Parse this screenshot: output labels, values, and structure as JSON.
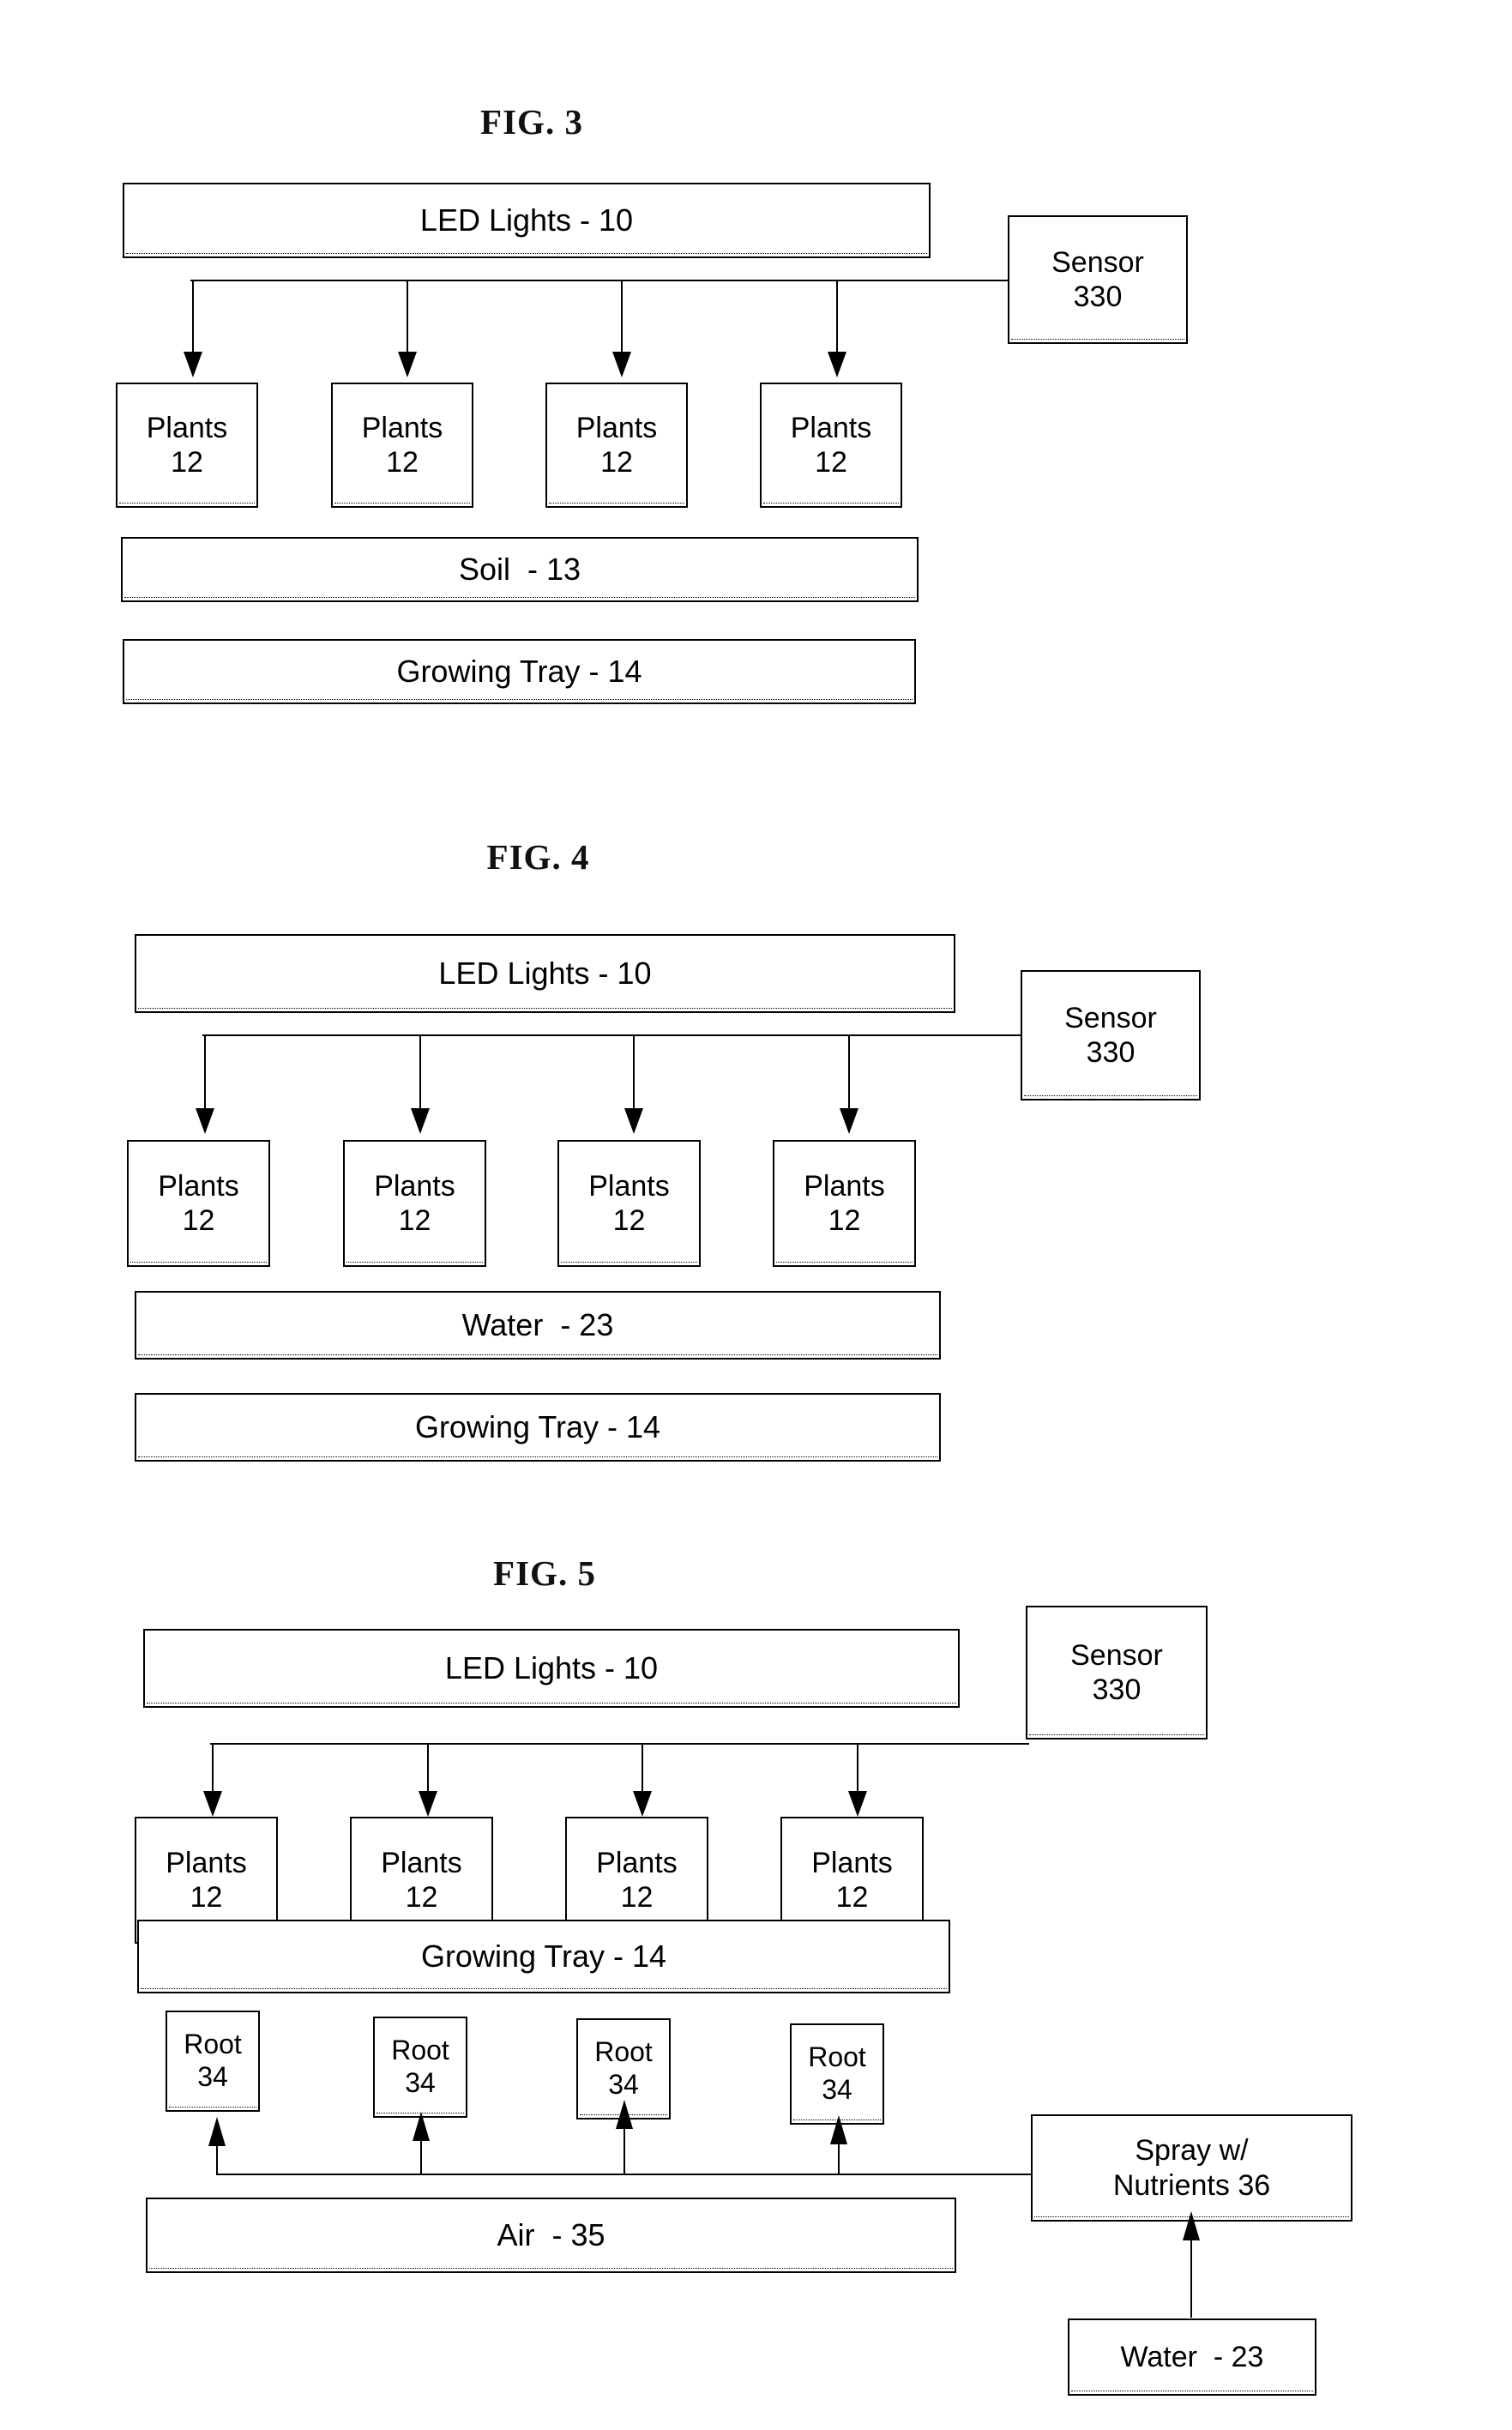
{
  "document": {
    "type": "patent-drawing-sheet",
    "background_color": "#ffffff",
    "line_color": "#000000"
  },
  "figures": [
    {
      "id": "fig3",
      "title": "FIG. 3",
      "boxes": {
        "led": "LED Lights - 10",
        "sensor": "Sensor\n330",
        "plants": [
          "Plants\n12",
          "Plants\n12",
          "Plants\n12",
          "Plants\n12"
        ],
        "medium": "Soil  - 13",
        "tray": "Growing Tray - 14"
      }
    },
    {
      "id": "fig4",
      "title": "FIG. 4",
      "boxes": {
        "led": "LED Lights - 10",
        "sensor": "Sensor\n330",
        "plants": [
          "Plants\n12",
          "Plants\n12",
          "Plants\n12",
          "Plants\n12"
        ],
        "medium": "Water  - 23",
        "tray": "Growing Tray - 14"
      }
    },
    {
      "id": "fig5",
      "title": "FIG. 5",
      "boxes": {
        "led": "LED Lights - 10",
        "sensor": "Sensor\n330",
        "plants": [
          "Plants\n12",
          "Plants\n12",
          "Plants\n12",
          "Plants\n12"
        ],
        "tray": "Growing Tray - 14",
        "roots": [
          "Root\n34",
          "Root\n34",
          "Root\n34",
          "Root\n34"
        ],
        "air": "Air  - 35",
        "spray": "Spray w/\nNutrients 36",
        "water": "Water  - 23"
      }
    }
  ]
}
